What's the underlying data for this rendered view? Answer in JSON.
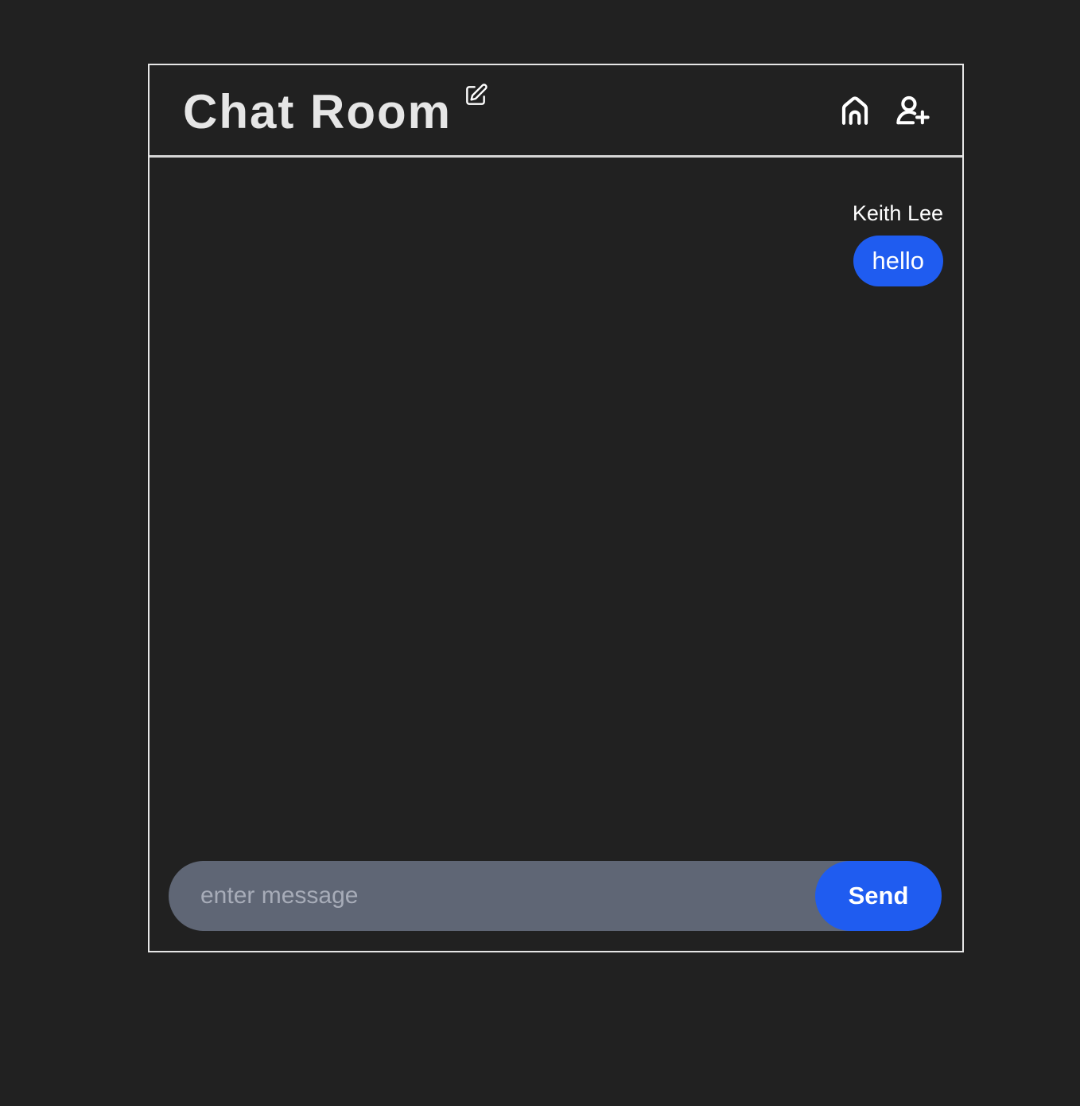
{
  "header": {
    "title": "Chat Room",
    "icons": {
      "edit": "edit-icon",
      "home": "home-icon",
      "add_user": "user-plus-icon"
    }
  },
  "messages": [
    {
      "sender": "Keith Lee",
      "text": "hello",
      "align": "right"
    }
  ],
  "composer": {
    "value": "",
    "placeholder": "enter message",
    "send_label": "Send"
  },
  "colors": {
    "background": "#212121",
    "accent": "#1f5cf0",
    "input_background": "#5f6675",
    "border": "#e6e6e6"
  }
}
